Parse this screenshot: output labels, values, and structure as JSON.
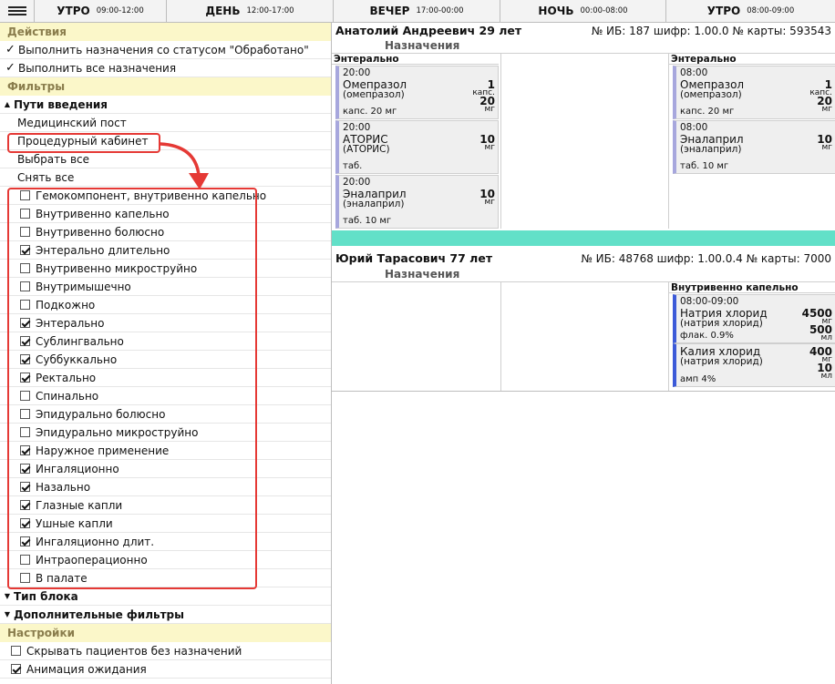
{
  "shifts": [
    {
      "name": "УТРО",
      "time": "09:00-12:00"
    },
    {
      "name": "ДЕНЬ",
      "time": "12:00-17:00"
    },
    {
      "name": "ВЕЧЕР",
      "time": "17:00-00:00"
    },
    {
      "name": "НОЧЬ",
      "time": "00:00-08:00"
    },
    {
      "name": "УТРО",
      "time": "08:00-09:00"
    }
  ],
  "left": {
    "actions_header": "Действия",
    "actions": [
      "Выполнить назначения со статусом \"Обработано\"",
      "Выполнить все назначения"
    ],
    "filters_header": "Фильтры",
    "routes_title": "Пути введения",
    "route_options": [
      "Медицинский пост",
      "Процедурный кабинет",
      "Выбрать все",
      "Снять все"
    ],
    "routes": [
      {
        "label": "Гемокомпонент, внутривенно капельно",
        "checked": false
      },
      {
        "label": "Внутривенно капельно",
        "checked": false
      },
      {
        "label": "Внутривенно болюсно",
        "checked": false
      },
      {
        "label": "Энтерально длительно",
        "checked": true
      },
      {
        "label": "Внутривенно микроструйно",
        "checked": false
      },
      {
        "label": "Внутримышечно",
        "checked": false
      },
      {
        "label": "Подкожно",
        "checked": false
      },
      {
        "label": "Энтерально",
        "checked": true
      },
      {
        "label": "Сублингвально",
        "checked": true
      },
      {
        "label": "Суббуккально",
        "checked": true
      },
      {
        "label": "Ректально",
        "checked": true
      },
      {
        "label": "Спинально",
        "checked": false
      },
      {
        "label": "Эпидурально болюсно",
        "checked": false
      },
      {
        "label": "Эпидурально микроструйно",
        "checked": false
      },
      {
        "label": "Наружное применение",
        "checked": true
      },
      {
        "label": "Ингаляционно",
        "checked": true
      },
      {
        "label": "Назально",
        "checked": true
      },
      {
        "label": "Глазные капли",
        "checked": true
      },
      {
        "label": "Ушные капли",
        "checked": true
      },
      {
        "label": "Ингаляционно длит.",
        "checked": true
      },
      {
        "label": "Интраоперационно",
        "checked": false
      },
      {
        "label": "В палате",
        "checked": false
      }
    ],
    "block_type": "Тип блока",
    "extra_filters": "Дополнительные фильтры",
    "settings_header": "Настройки",
    "settings": [
      {
        "label": "Скрывать пациентов без назначений",
        "checked": false
      },
      {
        "label": "Анимация ожидания",
        "checked": true
      }
    ]
  },
  "patients": [
    {
      "name": "Анатолий Андреевич 29 лет",
      "info": "№ ИБ: 187 шифр: 1.00.0 № карты: 593543",
      "section": "Назначения",
      "columns": [
        {
          "category": "Энтерально",
          "cards": [
            {
              "time": "20:00",
              "drug": "Омепразол",
              "generic": "(омепразол)",
              "form": "капс. 20 мг",
              "q1": "1",
              "u1": "капс.",
              "q2": "20",
              "u2": "мг"
            },
            {
              "time": "20:00",
              "drug": "АТОРИС",
              "generic": "(АТОРИС)",
              "form": "таб.",
              "q1": "10",
              "u1": "мг",
              "q2": "",
              "u2": ""
            },
            {
              "time": "20:00",
              "drug": "Эналаприл",
              "generic": "(эналаприл)",
              "form": "таб. 10 мг",
              "q1": "10",
              "u1": "мг",
              "q2": "",
              "u2": ""
            }
          ]
        },
        {
          "category": "",
          "cards": []
        },
        {
          "category": "Энтерально",
          "cards": [
            {
              "time": "08:00",
              "drug": "Омепразол",
              "generic": "(омепразол)",
              "form": "капс. 20 мг",
              "q1": "1",
              "u1": "капс.",
              "q2": "20",
              "u2": "мг"
            },
            {
              "time": "08:00",
              "drug": "Эналаприл",
              "generic": "(эналаприл)",
              "form": "таб. 10 мг",
              "q1": "10",
              "u1": "мг",
              "q2": "",
              "u2": ""
            }
          ]
        }
      ]
    },
    {
      "name": "Юрий Тарасович 77 лет",
      "info": "№ ИБ: 48768 шифр: 1.00.0.4 № карты: 7000",
      "section": "Назначения",
      "columns": [
        {
          "category": "",
          "cards": []
        },
        {
          "category": "",
          "cards": []
        },
        {
          "category": "Внутривенно капельно",
          "cards": [
            {
              "time": "08:00-09:00",
              "drug": "Натрия хлорид",
              "generic": "(натрия хлорид)",
              "form": "флак. 0.9%",
              "q1": "4500",
              "u1": "мг",
              "q2": "500",
              "u2": "мл"
            },
            {
              "time": "",
              "drug": "Калия хлорид",
              "generic": "(натрия хлорид)",
              "form": "амп 4%",
              "q1": "400",
              "u1": "мг",
              "q2": "10",
              "u2": "мл"
            }
          ]
        }
      ]
    }
  ]
}
